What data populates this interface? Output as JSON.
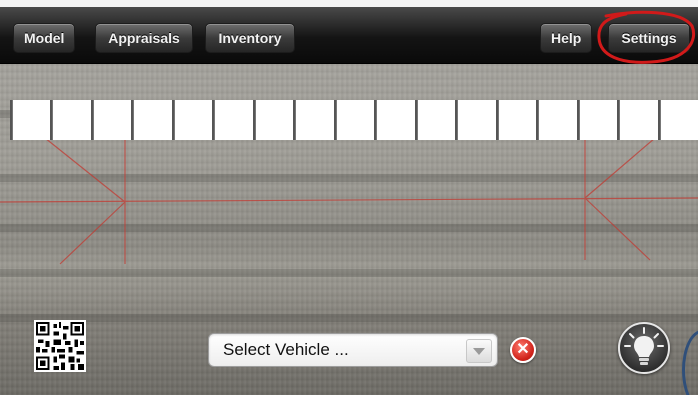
{
  "toolbar": {
    "model_label": "Model",
    "appraisals_label": "Appraisals",
    "inventory_label": "Inventory",
    "help_label": "Help",
    "settings_label": "Settings"
  },
  "measurement_strip": {
    "cell_count": 17
  },
  "vehicle_selector": {
    "selected_value": "Select Vehicle ...",
    "clear_icon": "close-icon"
  },
  "icons": {
    "qr": "qr-code-icon",
    "light": "light-bulb-icon",
    "dropdown": "chevron-down-icon"
  },
  "colors": {
    "toolbar": "#141414",
    "highlight_ring": "#d11a1a",
    "guide_lines": "#c23a32",
    "clear_button": "#d0231b"
  }
}
